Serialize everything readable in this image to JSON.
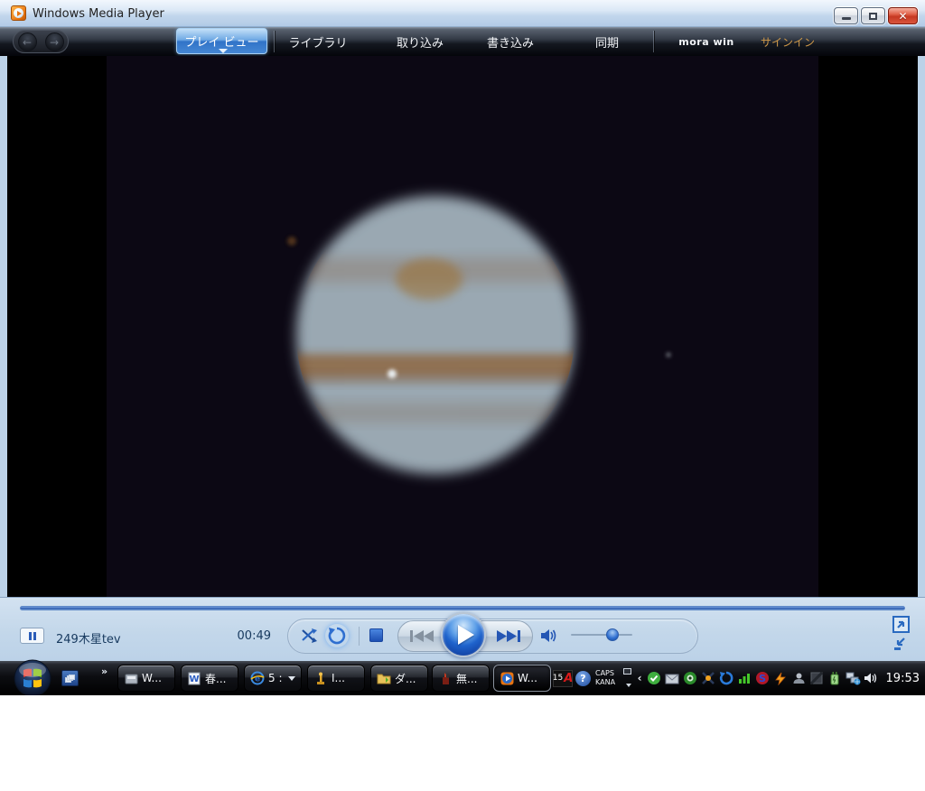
{
  "window": {
    "title": "Windows Media Player"
  },
  "tabs": {
    "play_view": "プレイ ビュー",
    "library": "ライブラリ",
    "rip": "取り込み",
    "burn": "書き込み",
    "sync": "同期",
    "mora_win": "mora win",
    "sign_in": "サインイン"
  },
  "player": {
    "now_playing": "249木星tev",
    "elapsed_time": "00:49"
  },
  "taskbar": {
    "overflow_chevron": "»",
    "buttons": [
      {
        "label": "W..."
      },
      {
        "label": "春..."
      },
      {
        "label": "5 :"
      },
      {
        "label": "I..."
      },
      {
        "label": "ダ..."
      },
      {
        "label": "無..."
      },
      {
        "label": "W...",
        "state": "active"
      }
    ],
    "tray": {
      "ime_version": "15",
      "ime_letter": "A",
      "help_glyph": "?",
      "caps": "CAPS",
      "kana": "KANA",
      "collapse_chevron": "‹",
      "clock": "19:53"
    }
  },
  "video": {
    "subject": "Jupiter with cloud bands, impact spot and moons"
  },
  "colors": {
    "accent_blue": "#2f6fc8",
    "signin_gold": "#d09a4a",
    "control_bar_bg": "#c3d7ea",
    "close_button_red": "#c63822",
    "band_orange": "#8a5422"
  }
}
